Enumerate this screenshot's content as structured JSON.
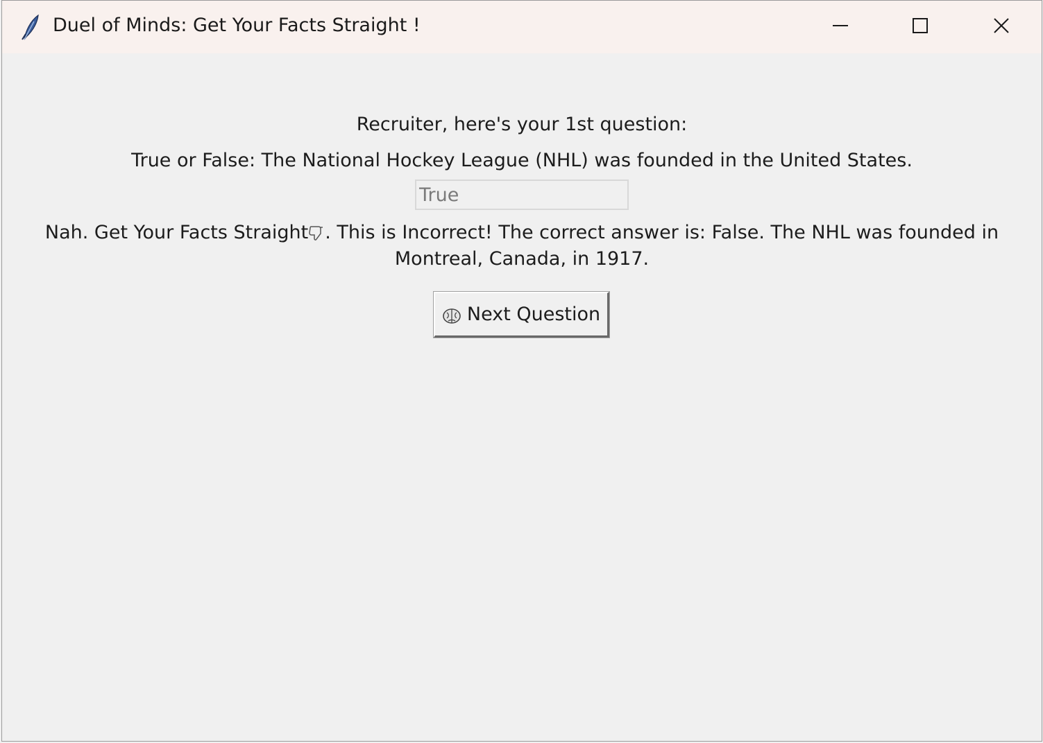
{
  "window": {
    "title": "Duel of Minds: Get Your Facts Straight !",
    "app_icon": "feather-icon",
    "controls": {
      "minimize_icon": "minimize-icon",
      "maximize_icon": "maximize-icon",
      "close_icon": "close-icon"
    }
  },
  "quiz": {
    "prompt": "Recruiter, here's your 1st question:",
    "question": "True or False: The National Hockey League (NHL) was founded in the United States.",
    "answer_value": "True",
    "feedback_before_icon": "Nah. Get Your Facts Straight",
    "feedback_icon": "thumbs-down-icon",
    "feedback_after_icon": ". This is Incorrect! The correct answer is: False. The NHL was founded in Montreal, Canada, in 1917.",
    "next_button_label": "Next Question",
    "next_button_icon": "brain-icon"
  }
}
